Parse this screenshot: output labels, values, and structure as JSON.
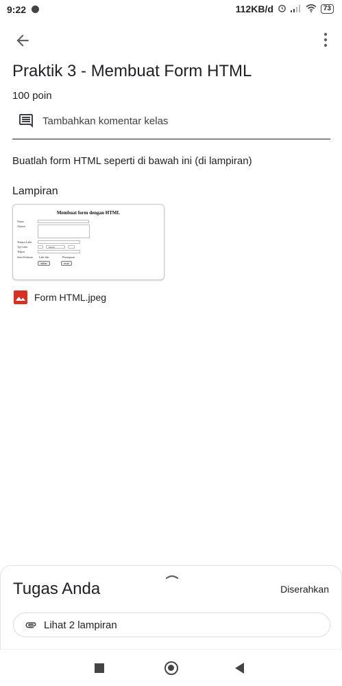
{
  "status_bar": {
    "time": "9:22",
    "network_speed": "112KB/d",
    "battery": "73"
  },
  "assignment": {
    "title": "Praktik 3 - Membuat Form HTML",
    "points": "100 poin",
    "comment_label": "Tambahkan komentar kelas",
    "instructions": "Buatlah form HTML seperti di bawah ini (di lampiran)",
    "attachments_heading": "Lampiran"
  },
  "attachment_preview": {
    "title": "Membuat form dengan HTML",
    "labels": [
      "Nama",
      "Alamat",
      "Tempat Lahir",
      "Tgl Lahir",
      "Telpon",
      "Jenis Kelamin"
    ],
    "select_value": "Januari",
    "radio_options": [
      "Laki-laki",
      "Perempuan"
    ],
    "buttons": [
      "daftar",
      "reset"
    ]
  },
  "attachment_file": {
    "name": "Form HTML.jpeg",
    "icon": "image-icon",
    "icon_color": "#d93025"
  },
  "your_work": {
    "title": "Tugas Anda",
    "status": "Diserahkan",
    "attachments_button": "Lihat 2 lampiran"
  }
}
